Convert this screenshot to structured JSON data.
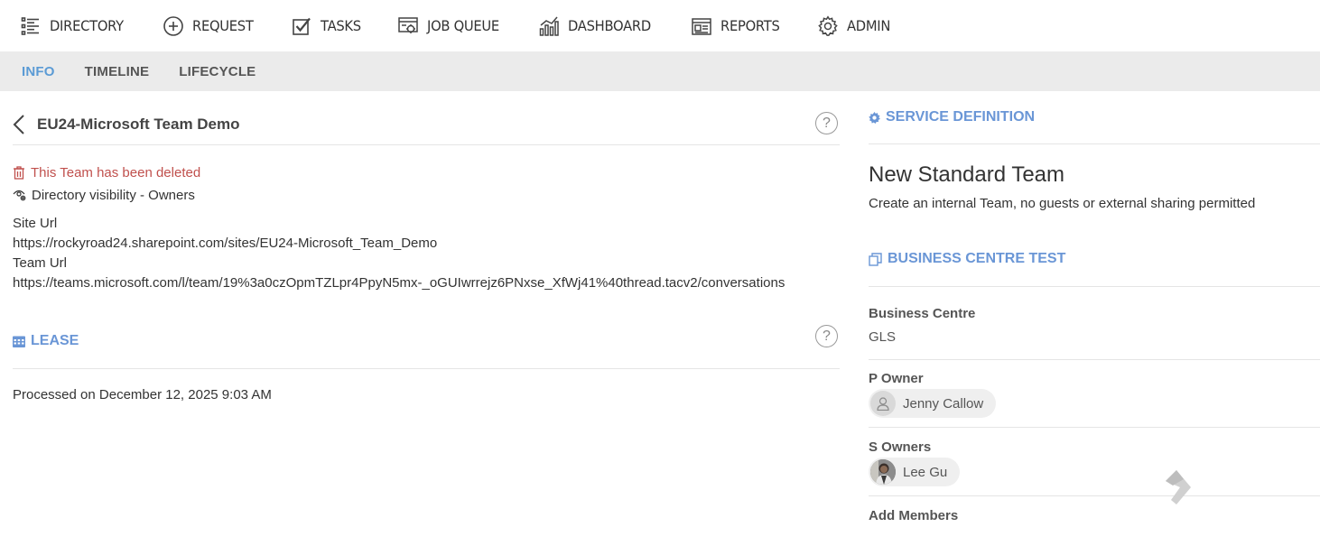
{
  "nav": {
    "items": [
      {
        "label": "DIRECTORY",
        "icon": "list-icon"
      },
      {
        "label": "REQUEST",
        "icon": "plus-circle-icon"
      },
      {
        "label": "TASKS",
        "icon": "checkbox-icon"
      },
      {
        "label": "JOB QUEUE",
        "icon": "job-queue-icon"
      },
      {
        "label": "DASHBOARD",
        "icon": "bar-chart-icon"
      },
      {
        "label": "REPORTS",
        "icon": "reports-icon"
      },
      {
        "label": "ADMIN",
        "icon": "gear-icon"
      }
    ]
  },
  "tabs": [
    {
      "label": "INFO",
      "active": true
    },
    {
      "label": "TIMELINE",
      "active": false
    },
    {
      "label": "LIFECYCLE",
      "active": false
    }
  ],
  "main": {
    "title": "EU24-Microsoft Team Demo",
    "help_glyph": "?",
    "status": "This Team has been deleted",
    "visibility": "Directory visibility - Owners",
    "site_url_label": "Site Url",
    "site_url": "https://rockyroad24.sharepoint.com/sites/EU24-Microsoft_Team_Demo",
    "team_url_label": "Team Url",
    "team_url": "https://teams.microsoft.com/l/team/19%3a0czOpmTZLpr4PpyN5mx-_oGUIwrrejz6PNxse_XfWj41%40thread.tacv2/conversations",
    "lease_heading": "LEASE",
    "processed": "Processed on December 12, 2025 9:03 AM"
  },
  "side": {
    "service_definition_heading": "SERVICE DEFINITION",
    "service_name": "New Standard Team",
    "service_description": "Create an internal Team, no guests or external sharing permitted",
    "business_centre_heading": "BUSINESS CENTRE TEST",
    "business_centre_label": "Business Centre",
    "business_centre_value": "GLS",
    "p_owner_label": "P Owner",
    "p_owner_name": "Jenny Callow",
    "s_owners_label": "S Owners",
    "s_owner_name": "Lee Gu",
    "add_members_label": "Add Members"
  },
  "colors": {
    "accent": "#5b9bd5",
    "section_heading": "#6a96d6",
    "deleted_status": "#c0504d",
    "tab_bar": "#ebebeb"
  }
}
